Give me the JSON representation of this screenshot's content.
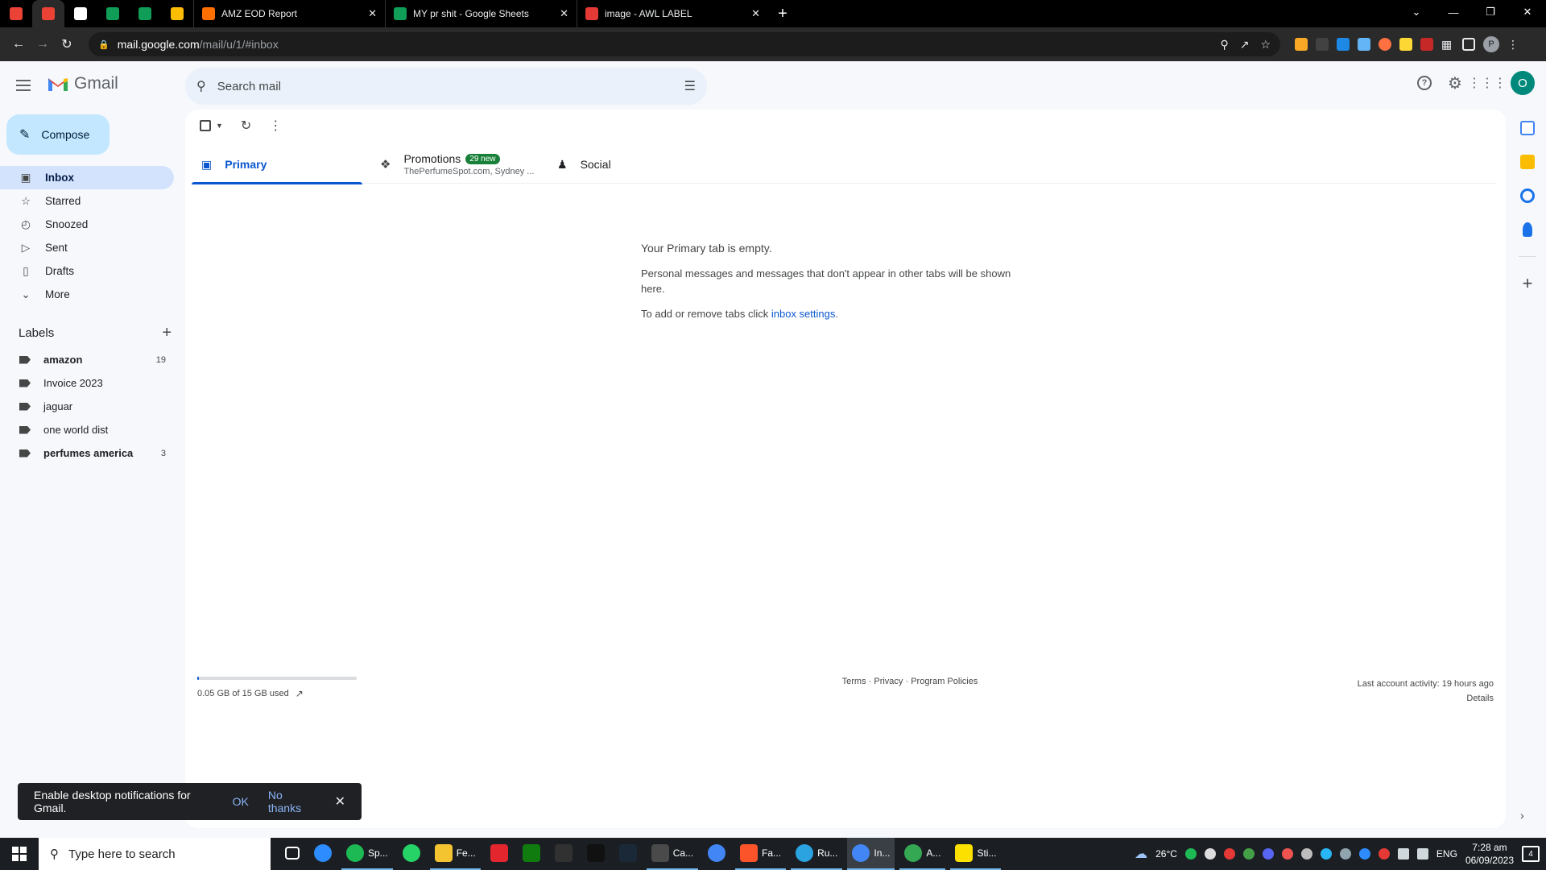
{
  "browser": {
    "pinned_tabs": [
      {
        "icon": "gmail-icon",
        "color": "#ea4335"
      },
      {
        "icon": "gmail-icon",
        "color": "#ea4335"
      },
      {
        "icon": "amazon-icon",
        "color": "#ffffff"
      },
      {
        "icon": "sheets-icon",
        "color": "#0f9d58"
      },
      {
        "icon": "sheets-icon",
        "color": "#0f9d58"
      },
      {
        "icon": "drive-icon",
        "color": "#fbbc04"
      }
    ],
    "tabs": [
      {
        "title": "AMZ EOD Report",
        "icon": "zapier-icon",
        "color": "#ff6f00"
      },
      {
        "title": "MY pr shit - Google Sheets",
        "icon": "sheets-icon",
        "color": "#0f9d58"
      },
      {
        "title": "image - AWL LABEL",
        "icon": "airtable-icon",
        "color": "#e53935"
      }
    ],
    "url_host": "mail.google.com",
    "url_path": "/mail/u/1/#inbox",
    "profile_initial": "P"
  },
  "gmail": {
    "logo_text": "Gmail",
    "search_placeholder": "Search mail",
    "avatar_initial": "O",
    "compose_label": "Compose",
    "nav": [
      {
        "label": "Inbox",
        "icon": "inbox-icon",
        "active": true
      },
      {
        "label": "Starred",
        "icon": "star-icon"
      },
      {
        "label": "Snoozed",
        "icon": "clock-icon"
      },
      {
        "label": "Sent",
        "icon": "send-icon"
      },
      {
        "label": "Drafts",
        "icon": "draft-icon"
      },
      {
        "label": "More",
        "icon": "chevron-down-icon"
      }
    ],
    "labels_heading": "Labels",
    "labels": [
      {
        "name": "amazon",
        "count": "19",
        "bold": true
      },
      {
        "name": "Invoice 2023",
        "count": ""
      },
      {
        "name": "jaguar",
        "count": ""
      },
      {
        "name": "one world dist",
        "count": ""
      },
      {
        "name": "perfumes america",
        "count": "3",
        "bold": true
      }
    ],
    "tabs": {
      "primary": "Primary",
      "promotions": "Promotions",
      "promotions_badge": "29 new",
      "promotions_senders": "ThePerfumeSpot.com, Sydney ...",
      "social": "Social"
    },
    "empty": {
      "title": "Your Primary tab is empty.",
      "body": "Personal messages and messages that don't appear in other tabs will be shown here.",
      "settings_prefix": "To add or remove tabs click ",
      "settings_link": "inbox settings",
      "settings_suffix": "."
    },
    "footer": {
      "storage_text": "0.05 GB of 15 GB used",
      "storage_fraction": 0.0033,
      "links": "Terms · Privacy · Program Policies",
      "activity": "Last account activity: 19 hours ago",
      "details": "Details"
    },
    "snackbar": {
      "message": "Enable desktop notifications for Gmail.",
      "ok": "OK",
      "no_thanks": "No thanks"
    }
  },
  "taskbar": {
    "search_placeholder": "Type here to search",
    "apps": [
      {
        "label": "",
        "icon": "task-view-icon",
        "color": "#ffffff"
      },
      {
        "label": "",
        "icon": "zoom-icon",
        "color": "#2d8cff"
      },
      {
        "label": "Sp...",
        "icon": "spotify-icon",
        "color": "#1db954"
      },
      {
        "label": "",
        "icon": "whatsapp-icon",
        "color": "#25d366"
      },
      {
        "label": "Fe...",
        "icon": "file-explorer-icon",
        "color": "#f4c430"
      },
      {
        "label": "",
        "icon": "amd-icon",
        "color": "#e3262e"
      },
      {
        "label": "",
        "icon": "xbox-icon",
        "color": "#107c10"
      },
      {
        "label": "",
        "icon": "epic-games-icon",
        "color": "#313131"
      },
      {
        "label": "",
        "icon": "tiktok-icon",
        "color": "#111111"
      },
      {
        "label": "",
        "icon": "steam-icon",
        "color": "#1b2838"
      },
      {
        "label": "Ca...",
        "icon": "calculator-icon",
        "color": "#4a4a4a"
      },
      {
        "label": "",
        "icon": "chrome-icon",
        "color": "#4285f4"
      },
      {
        "label": "Fa...",
        "icon": "brave-icon",
        "color": "#fb542b"
      },
      {
        "label": "Ru...",
        "icon": "telegram-icon",
        "color": "#2aa3e0"
      },
      {
        "label": "In...",
        "icon": "chrome-profile-icon",
        "color": "#4285f4"
      },
      {
        "label": "A...",
        "icon": "chrome-profile-icon",
        "color": "#34a853"
      },
      {
        "label": "Sti...",
        "icon": "sticky-notes-icon",
        "color": "#fce100"
      }
    ],
    "weather": "26°C",
    "language": "ENG",
    "time": "7:28 am",
    "date": "06/09/2023",
    "notifications_count": "4"
  }
}
